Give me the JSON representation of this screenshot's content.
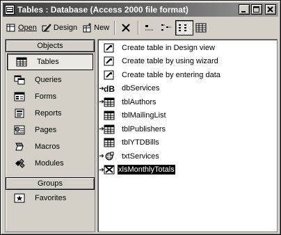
{
  "window": {
    "title": "Tables : Database (Access 2000 file format)",
    "controls": {
      "minimize": "_",
      "maximize": "□",
      "close": "X"
    }
  },
  "toolbar": {
    "open_label": "Open",
    "design_label": "Design",
    "new_label": "New"
  },
  "objects": {
    "header": "Objects",
    "items": [
      {
        "label": "Tables",
        "icon": "table-icon",
        "selected": true
      },
      {
        "label": "Queries",
        "icon": "query-icon"
      },
      {
        "label": "Forms",
        "icon": "form-icon"
      },
      {
        "label": "Reports",
        "icon": "report-icon"
      },
      {
        "label": "Pages",
        "icon": "page-icon"
      },
      {
        "label": "Macros",
        "icon": "macro-icon"
      },
      {
        "label": "Modules",
        "icon": "module-icon"
      }
    ]
  },
  "groups": {
    "header": "Groups",
    "items": [
      {
        "label": "Favorites",
        "icon": "favorites-icon"
      }
    ]
  },
  "list": {
    "items": [
      {
        "label": "Create table in Design view",
        "icon": "wizard-icon"
      },
      {
        "label": "Create table by using wizard",
        "icon": "wizard-icon"
      },
      {
        "label": "Create table by entering data",
        "icon": "wizard-icon"
      },
      {
        "label": "dbServices",
        "icon": "dbase-link-icon",
        "linked": true
      },
      {
        "label": "tblAuthors",
        "icon": "linked-table-icon",
        "linked": true
      },
      {
        "label": "tblMailingList",
        "icon": "table-icon"
      },
      {
        "label": "tblPublishers",
        "icon": "linked-table-icon",
        "linked": true
      },
      {
        "label": "tblYTDBills",
        "icon": "table-icon"
      },
      {
        "label": "txtServices",
        "icon": "text-link-icon",
        "linked": true
      },
      {
        "label": "xlsMonthlyTotals",
        "icon": "excel-link-icon",
        "linked": true,
        "selected": true
      }
    ]
  }
}
